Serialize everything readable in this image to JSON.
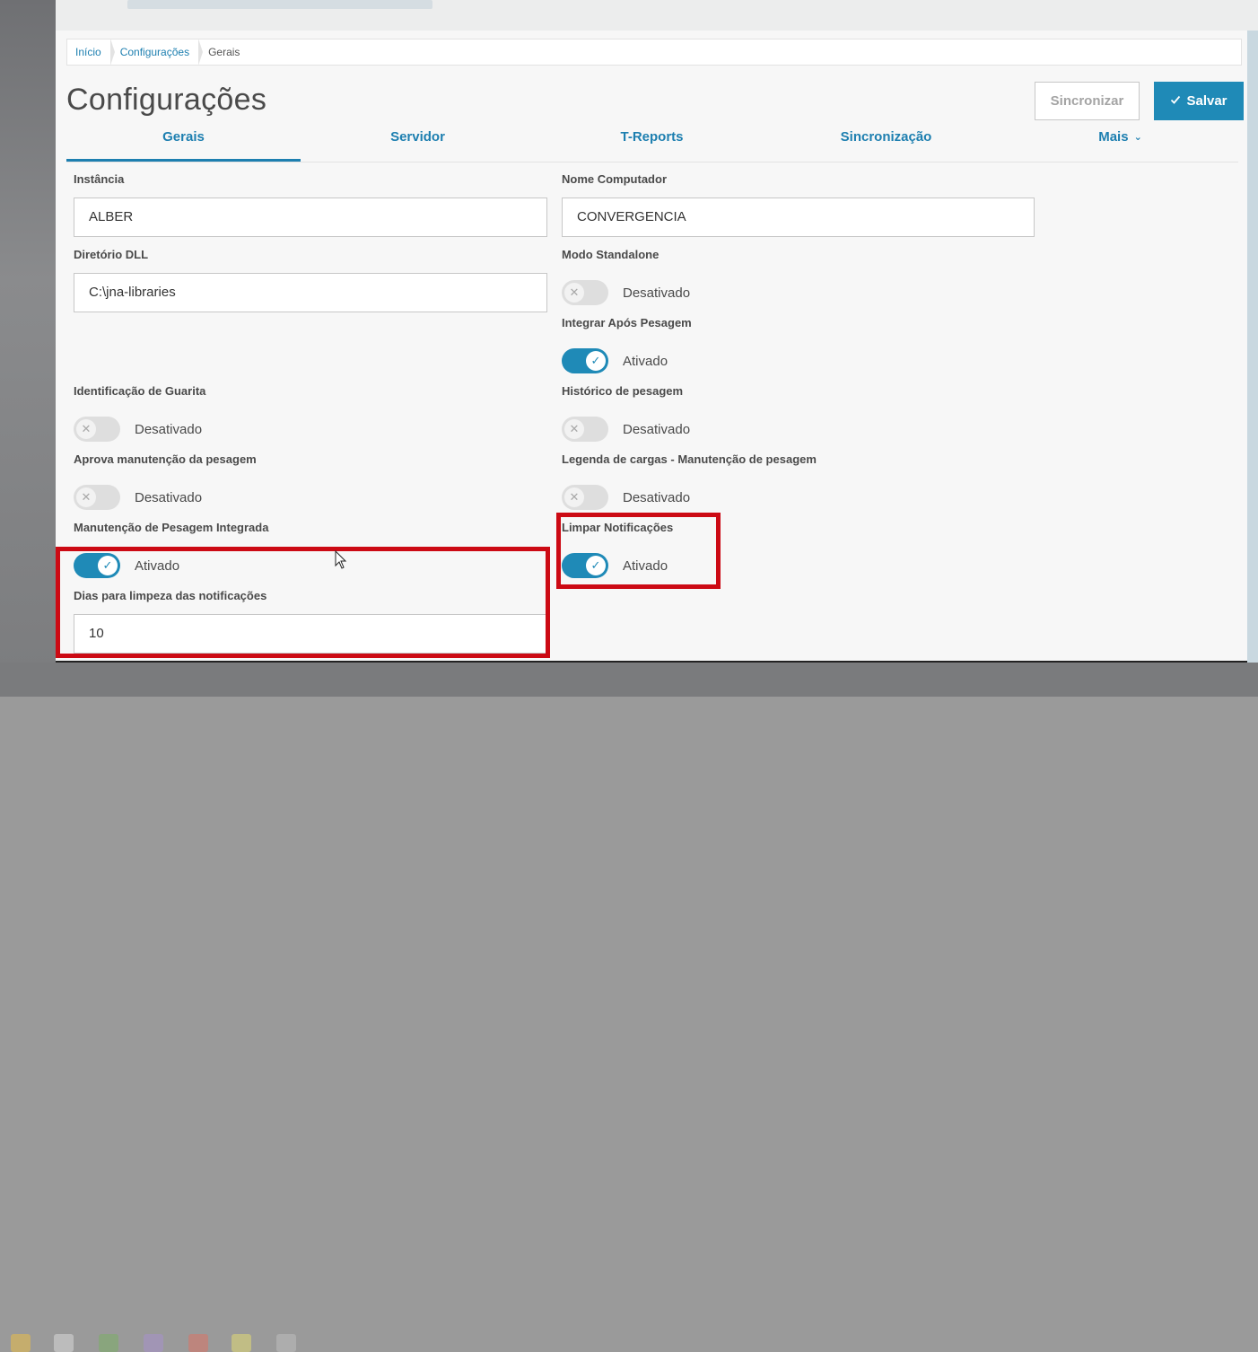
{
  "breadcrumb": [
    "Início",
    "Configurações",
    "Gerais"
  ],
  "page_title": "Configurações",
  "buttons": {
    "sync": "Sincronizar",
    "save": "Salvar"
  },
  "tabs": [
    {
      "label": "Gerais",
      "active": true
    },
    {
      "label": "Servidor",
      "active": false
    },
    {
      "label": "T-Reports",
      "active": false
    },
    {
      "label": "Sincronização",
      "active": false
    },
    {
      "label": "Mais",
      "active": false
    }
  ],
  "fields": {
    "instancia": {
      "label": "Instância",
      "value": "ALBER"
    },
    "nome_computador": {
      "label": "Nome Computador",
      "value": "CONVERGENCIA"
    },
    "diretorio_dll": {
      "label": "Diretório DLL",
      "value": "C:\\jna-libraries"
    },
    "dias_limpeza": {
      "label": "Dias para limpeza das notificações",
      "value": "10"
    }
  },
  "switches": {
    "modo_standalone": {
      "label": "Modo Standalone",
      "state": "Desativado",
      "on": false
    },
    "integrar_apos_pesagem": {
      "label": "Integrar Após Pesagem",
      "state": "Ativado",
      "on": true
    },
    "identificacao_guarita": {
      "label": "Identificação de Guarita",
      "state": "Desativado",
      "on": false
    },
    "historico_pesagem": {
      "label": "Histórico de pesagem",
      "state": "Desativado",
      "on": false
    },
    "aprova_manutencao": {
      "label": "Aprova manutenção da pesagem",
      "state": "Desativado",
      "on": false
    },
    "legenda_cargas": {
      "label": "Legenda de cargas - Manutenção de pesagem",
      "state": "Desativado",
      "on": false
    },
    "manutencao_integrada": {
      "label": "Manutenção de Pesagem Integrada",
      "state": "Ativado",
      "on": true
    },
    "limpar_notificacoes": {
      "label": "Limpar Notificações",
      "state": "Ativado",
      "on": true
    }
  },
  "colors": {
    "primary": "#1f8ab7",
    "highlight": "#cc0a14",
    "switch_off": "#dedede"
  },
  "icons": {
    "check": "check-icon",
    "close": "x-icon",
    "chevron": "chevron-down-icon"
  }
}
